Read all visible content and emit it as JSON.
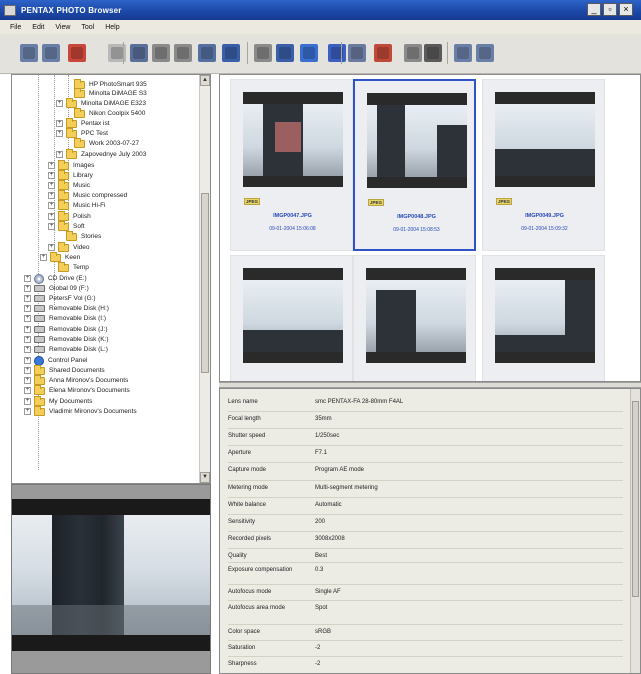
{
  "window": {
    "title": "PENTAX PHOTO Browser",
    "controls": [
      "_",
      "▫",
      "×"
    ]
  },
  "menu": [
    "File",
    "Edit",
    "View",
    "Tool",
    "Help"
  ],
  "toolbar": {
    "colors": [
      "#6a7fa8",
      "#6a7fa8",
      "#c8463a",
      "#b8b8b8",
      "#5a6f9a",
      "#8a8a8a",
      "#8a8a8a",
      "#5570a0",
      "#3a5fa8",
      "#8a8a8a",
      "#3a5fa8",
      "#3a6fd0",
      "#3a5fc0",
      "#6a7aa0",
      "#c04a3a",
      "#8a8a8a",
      "#5a5a5a"
    ]
  },
  "tree": {
    "items": [
      {
        "label": "HP PhotoSmart 935",
        "icon": "folder-icon",
        "indent": 7,
        "exp": ""
      },
      {
        "label": "Minolta DiMAGE S3",
        "icon": "folder-icon",
        "indent": 7,
        "exp": ""
      },
      {
        "label": "Minolta DiMAGE E323",
        "icon": "folder-icon",
        "indent": 6,
        "exp": "+"
      },
      {
        "label": "Nikon Coolpix 5400",
        "icon": "folder-icon",
        "indent": 7,
        "exp": ""
      },
      {
        "label": "Pentax ist",
        "icon": "folder-icon",
        "indent": 6,
        "exp": "+"
      },
      {
        "label": "PPC Test",
        "icon": "folder-icon",
        "indent": 6,
        "exp": "+"
      },
      {
        "label": "Work 2003-07-27",
        "icon": "folder-icon",
        "indent": 7,
        "exp": ""
      },
      {
        "label": "Zapovednye July 2003",
        "icon": "folder-icon",
        "indent": 6,
        "exp": "+"
      },
      {
        "label": "Images",
        "icon": "folder-icon",
        "indent": 5,
        "exp": "+"
      },
      {
        "label": "Library",
        "icon": "folder-icon",
        "indent": 5,
        "exp": "+"
      },
      {
        "label": "Music",
        "icon": "folder-icon",
        "indent": 5,
        "exp": "+"
      },
      {
        "label": "Music compressed",
        "icon": "folder-icon",
        "indent": 5,
        "exp": "+"
      },
      {
        "label": "Music Hi-Fi",
        "icon": "folder-icon",
        "indent": 5,
        "exp": "+"
      },
      {
        "label": "Polish",
        "icon": "folder-icon",
        "indent": 5,
        "exp": "+"
      },
      {
        "label": "Soft",
        "icon": "folder-icon",
        "indent": 5,
        "exp": "+"
      },
      {
        "label": "Stories",
        "icon": "folder-icon",
        "indent": 6,
        "exp": ""
      },
      {
        "label": "Video",
        "icon": "folder-icon",
        "indent": 5,
        "exp": "+"
      },
      {
        "label": "Keen",
        "icon": "folder-icon",
        "indent": 4,
        "exp": "+"
      },
      {
        "label": "Temp",
        "icon": "folder-icon",
        "indent": 5,
        "exp": ""
      },
      {
        "label": "CD Drive (E:)",
        "icon": "cd-icon",
        "indent": 2,
        "exp": "+"
      },
      {
        "label": "Global 09 (F:)",
        "icon": "drive-icon",
        "indent": 2,
        "exp": "+"
      },
      {
        "label": "PetersF Vol (G:)",
        "icon": "drive-icon",
        "indent": 2,
        "exp": "+"
      },
      {
        "label": "Removable Disk (H:)",
        "icon": "drive-icon",
        "indent": 2,
        "exp": "+"
      },
      {
        "label": "Removable Disk (I:)",
        "icon": "drive-icon",
        "indent": 2,
        "exp": "+"
      },
      {
        "label": "Removable Disk (J:)",
        "icon": "drive-icon",
        "indent": 2,
        "exp": "+"
      },
      {
        "label": "Removable Disk (K:)",
        "icon": "drive-icon",
        "indent": 2,
        "exp": "+"
      },
      {
        "label": "Removable Disk (L:)",
        "icon": "drive-icon",
        "indent": 2,
        "exp": "+"
      },
      {
        "label": "Control Panel",
        "icon": "control-panel-icon",
        "indent": 2,
        "exp": "+"
      },
      {
        "label": "Shared Documents",
        "icon": "folder-icon",
        "indent": 2,
        "exp": "+"
      },
      {
        "label": "Anna Mironov's Documents",
        "icon": "folder-icon",
        "indent": 2,
        "exp": "+"
      },
      {
        "label": "Elena Mironov's Documents",
        "icon": "folder-icon",
        "indent": 2,
        "exp": "+"
      },
      {
        "label": "My Documents",
        "icon": "folder-icon",
        "indent": 2,
        "exp": "+"
      },
      {
        "label": "Vladimir Mironov's Documents",
        "icon": "folder-icon",
        "indent": 2,
        "exp": "+"
      }
    ]
  },
  "thumbnails": [
    {
      "name": "IMGP0047.JPG",
      "date": "09-01-2004 15:06:08",
      "badge": "JPEG",
      "selected": false
    },
    {
      "name": "IMGP0048.JPG",
      "date": "09-01-2004 15:08:53",
      "badge": "JPEG",
      "selected": true
    },
    {
      "name": "IMGP0049.JPG",
      "date": "09-01-2004 15:09:32",
      "badge": "JPEG",
      "selected": false
    },
    {
      "name": "",
      "date": "",
      "badge": "",
      "selected": false
    },
    {
      "name": "",
      "date": "",
      "badge": "",
      "selected": false
    },
    {
      "name": "",
      "date": "",
      "badge": "",
      "selected": false
    }
  ],
  "info": [
    {
      "label": "Lens name",
      "value": "smc PENTAX-FA 28-80mm F4AL"
    },
    {
      "label": "Focal length",
      "value": "35mm"
    },
    {
      "label": "Shutter speed",
      "value": "1/250sec"
    },
    {
      "label": "Aperture",
      "value": "F7.1"
    },
    {
      "label": "Capture mode",
      "value": "Program AE mode"
    },
    {
      "label": "Metering mode",
      "value": "Multi-segment metering"
    },
    {
      "label": "White balance",
      "value": "Automatic"
    },
    {
      "label": "Sensitivity",
      "value": "200"
    },
    {
      "label": "Recorded pixels",
      "value": "3008x2008"
    },
    {
      "label": "Quality",
      "value": "Best"
    },
    {
      "label": "Exposure compensation",
      "value": "0.3"
    },
    {
      "label": "Autofocus mode",
      "value": "Single AF"
    },
    {
      "label": "Autofocus area mode",
      "value": "Spot"
    },
    {
      "label": "Color space",
      "value": "sRGB"
    },
    {
      "label": "Saturation",
      "value": "-2"
    },
    {
      "label": "Sharpness",
      "value": "-2"
    }
  ]
}
